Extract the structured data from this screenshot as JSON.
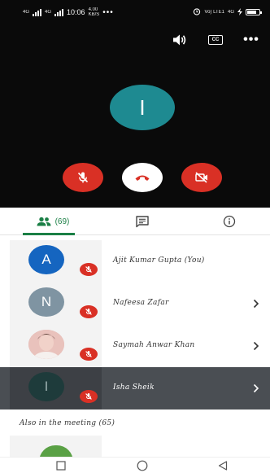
{
  "status_bar": {
    "network_left": "4G",
    "network_left_2": "4G",
    "time": "10:06",
    "speed_top": "4.00",
    "speed_bottom": "KB/S",
    "dots": "•••",
    "right_network": "Vo) LTE1",
    "right_signal": "4G"
  },
  "call": {
    "cc_label": "CC",
    "more_label": "•••",
    "self_initial": "I",
    "colors": {
      "background": "#0a0a0a",
      "self_avatar": "#1e8a91",
      "end_call": "#ffffff",
      "red_button": "#d93025"
    }
  },
  "tabs": {
    "people_count": "(69)",
    "accent": "#1a7f45"
  },
  "participants": [
    {
      "name": "Ajit Kumar Gupta (You)",
      "initial": "A",
      "color": "#1565c0",
      "muted": true,
      "has_chevron": false
    },
    {
      "name": "Nafeesa Zafar",
      "initial": "N",
      "color": "#7f94a2",
      "muted": true,
      "has_chevron": true
    },
    {
      "name": "Saymah Anwar Khan",
      "initial": "",
      "color": "#d9a7a2",
      "muted": true,
      "has_chevron": true
    },
    {
      "name": "Isha Sheik",
      "initial": "I",
      "color": "#1e3b3b",
      "muted": true,
      "has_chevron": true
    }
  ],
  "also_in_meeting": "Also in the meeting (65)"
}
